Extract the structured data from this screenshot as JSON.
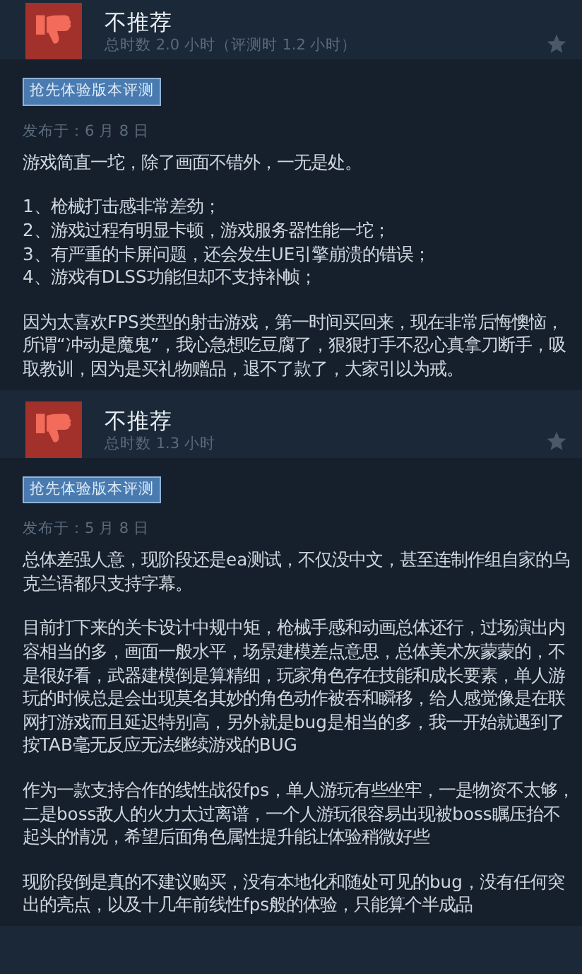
{
  "reviews": [
    {
      "verdict": "不推荐",
      "hours": "总时数 2.0 小时（评测时 1.2 小时）",
      "badge": "抢先体验版本评测",
      "date": "发布于：6 月 8 日",
      "body": [
        {
          "kind": "text",
          "text": "游戏简直一坨，除了画面不错外，一无是处。"
        },
        {
          "kind": "list",
          "items": [
            "1、枪械打击感非常差劲；",
            "2、游戏过程有明显卡顿，游戏服务器性能一坨；",
            "3、有严重的卡屏问题，还会发生UE引擎崩溃的错误；",
            "4、游戏有DLSS功能但却不支持补帧；"
          ]
        },
        {
          "kind": "text",
          "text": "因为太喜欢FPS类型的射击游戏，第一时间买回来，现在非常后悔懊恼，所谓“冲动是魔鬼”，我心急想吃豆腐了，狠狠打手不忍心真拿刀断手，吸取教训，因为是买礼物赠品，退不了款了，大家引以为戒。"
        }
      ]
    },
    {
      "verdict": "不推荐",
      "hours": "总时数 1.3 小时",
      "badge": "抢先体验版本评测",
      "date": "发布于：5 月 8 日",
      "body": [
        {
          "kind": "text",
          "text": "总体差强人意，现阶段还是ea测试，不仅没中文，甚至连制作组自家的乌克兰语都只支持字幕。"
        },
        {
          "kind": "text",
          "text": "目前打下来的关卡设计中规中矩，枪械手感和动画总体还行，过场演出内容相当的多，画面一般水平，场景建模差点意思，总体美术灰蒙蒙的，不是很好看，武器建模倒是算精细，玩家角色存在技能和成长要素，单人游玩的时候总是会出现莫名其妙的角色动作被吞和瞬移，给人感觉像是在联网打游戏而且延迟特别高，另外就是bug是相当的多，我一开始就遇到了按TAB毫无反应无法继续游戏的BUG"
        },
        {
          "kind": "text",
          "text": "作为一款支持合作的线性战役fps，单人游玩有些坐牢，一是物资不太够，二是boss敌人的火力太过离谱，一个人游玩很容易出现被boss瞩压抬不起头的情况，希望后面角色属性提升能让体验稍微好些"
        },
        {
          "kind": "text",
          "text": "现阶段倒是真的不建议购买，没有本地化和随处可见的bug，没有任何突出的亮点，以及十几年前线性fps般的体验，只能算个半成品"
        }
      ]
    }
  ]
}
